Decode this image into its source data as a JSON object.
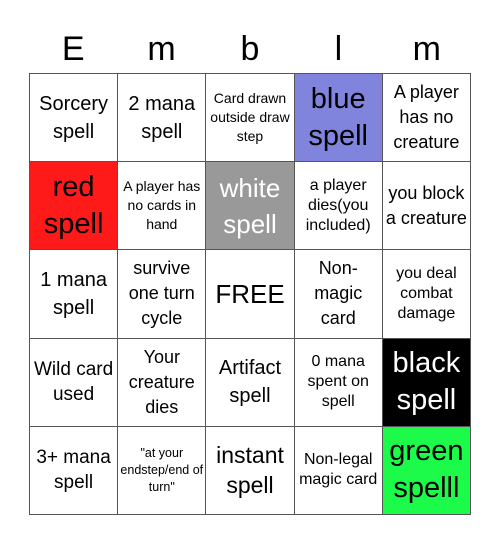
{
  "header": [
    "E",
    "m",
    "b",
    "l",
    "m"
  ],
  "colors": {
    "red": "#ff1a1a",
    "white": "#999999",
    "blue": "#8084dc",
    "black": "#000000",
    "green": "#1dfb4a"
  },
  "cells": [
    {
      "text": "Sorcery spell",
      "bg": "#ffffff",
      "fg": "#000000"
    },
    {
      "text": "2 mana spell",
      "bg": "#ffffff",
      "fg": "#000000"
    },
    {
      "text": "Card drawn outside draw step",
      "bg": "#ffffff",
      "fg": "#000000"
    },
    {
      "text": "blue spell",
      "bg": "#8084dc",
      "fg": "#000000"
    },
    {
      "text": "A player has no creature",
      "bg": "#ffffff",
      "fg": "#000000"
    },
    {
      "text": "red spell",
      "bg": "#ff1a1a",
      "fg": "#000000"
    },
    {
      "text": "A player has no cards in hand",
      "bg": "#ffffff",
      "fg": "#000000"
    },
    {
      "text": "white spell",
      "bg": "#999999",
      "fg": "#ffffff"
    },
    {
      "text": "a player dies(you included)",
      "bg": "#ffffff",
      "fg": "#000000"
    },
    {
      "text": "you block a creature",
      "bg": "#ffffff",
      "fg": "#000000"
    },
    {
      "text": "1 mana spell",
      "bg": "#ffffff",
      "fg": "#000000"
    },
    {
      "text": "survive one turn cycle",
      "bg": "#ffffff",
      "fg": "#000000"
    },
    {
      "text": "FREE",
      "bg": "#ffffff",
      "fg": "#000000"
    },
    {
      "text": "Non-magic card",
      "bg": "#ffffff",
      "fg": "#000000"
    },
    {
      "text": "you deal combat damage",
      "bg": "#ffffff",
      "fg": "#000000"
    },
    {
      "text": "Wild card used",
      "bg": "#ffffff",
      "fg": "#000000"
    },
    {
      "text": "Your creature dies",
      "bg": "#ffffff",
      "fg": "#000000"
    },
    {
      "text": "Artifact spell",
      "bg": "#ffffff",
      "fg": "#000000"
    },
    {
      "text": "0 mana spent on spell",
      "bg": "#ffffff",
      "fg": "#000000"
    },
    {
      "text": "black spell",
      "bg": "#000000",
      "fg": "#ffffff"
    },
    {
      "text": "3+ mana spell",
      "bg": "#ffffff",
      "fg": "#000000"
    },
    {
      "text": "\"at your endstep/end of turn\"",
      "bg": "#ffffff",
      "fg": "#000000"
    },
    {
      "text": "instant spell",
      "bg": "#ffffff",
      "fg": "#000000"
    },
    {
      "text": "Non-legal magic card",
      "bg": "#ffffff",
      "fg": "#000000"
    },
    {
      "text": "green spelll",
      "bg": "#1dfb4a",
      "fg": "#000000"
    }
  ]
}
